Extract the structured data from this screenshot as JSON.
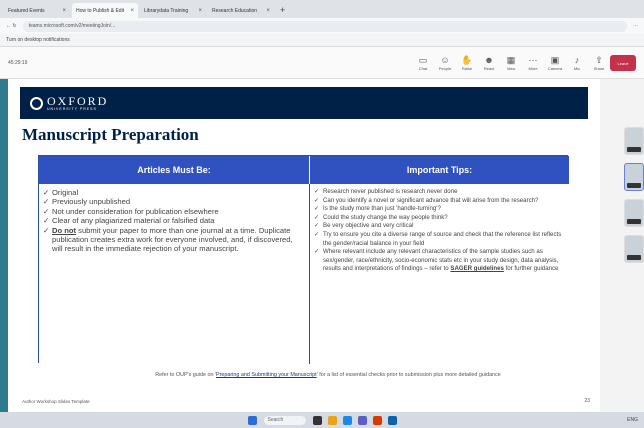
{
  "browser": {
    "tabs": [
      {
        "label": "Featured Events"
      },
      {
        "label": "How to Publish & Edit"
      },
      {
        "label": "Librarydata Training"
      },
      {
        "label": "Research Education"
      }
    ],
    "active_tab_index": 1,
    "url": "teams.microsoft.com/v2/meetingJoin/...",
    "notification": "Turn on desktop notifications"
  },
  "meeting": {
    "timer": "45:29:19",
    "tools": [
      {
        "label": "Chat",
        "icon": "chat-icon"
      },
      {
        "label": "People",
        "icon": "people-icon"
      },
      {
        "label": "Raise",
        "icon": "raise-hand-icon"
      },
      {
        "label": "React",
        "icon": "react-icon"
      },
      {
        "label": "View",
        "icon": "view-icon"
      },
      {
        "label": "More",
        "icon": "more-icon"
      },
      {
        "label": "Camera",
        "icon": "camera-icon"
      },
      {
        "label": "Mic",
        "icon": "mic-icon"
      },
      {
        "label": "Share",
        "icon": "share-icon"
      },
      {
        "label": "Leave",
        "icon": "leave-icon"
      }
    ]
  },
  "slide": {
    "brand_name": "OXFORD",
    "brand_sub": "UNIVERSITY PRESS",
    "title": "Manuscript Preparation",
    "left_header": "Articles Must Be:",
    "right_header": "Important Tips:",
    "left_items": [
      {
        "pre": "",
        "bold": "",
        "text": "Original"
      },
      {
        "pre": "",
        "bold": "",
        "text": "Previously unpublished"
      },
      {
        "pre": "",
        "bold": "",
        "text": "Not under consideration for publication elsewhere"
      },
      {
        "pre": "",
        "bold": "",
        "text": "Clear of any plagiarized material or falsified data"
      },
      {
        "pre": "",
        "bold": "Do not",
        "text": " submit your paper to more than one journal at a time. Duplicate publication creates extra work for everyone involved, and, if discovered, will result in the immediate rejection of your manuscript."
      }
    ],
    "right_items": [
      {
        "text": "Research never published is research never done"
      },
      {
        "text": "Can you identify a novel or significant advance that will arise from the research?"
      },
      {
        "text": "Is the study more than just 'handle-turning'?"
      },
      {
        "text": "Could the study change the way people think?"
      },
      {
        "text": "Be very objective and very critical"
      },
      {
        "text": "Try to ensure you cite a diverse range of source and check that the reference list reflects the gender/racial balance in your field"
      },
      {
        "text": "Where relevant include any relevant characteristics of the sample studies such as sex/gender, race/ethnicity, socio-economic stats etc in your study design, data analysis, results and interpretations of findings – refer to ",
        "link": "SAGER guidelines",
        "after": " for further guidance"
      }
    ],
    "footer_ref_pre": "Refer to OUP's guide on '",
    "footer_ref_link": "Preparing and Submitting your Manuscript",
    "footer_ref_post": "' for a list of essential checks prior to submission plus more detailed guidance",
    "footer_left": "Author Workshop Slides Template",
    "page_number": "23"
  },
  "taskbar": {
    "search_placeholder": "Search",
    "right_text": "ENG"
  }
}
